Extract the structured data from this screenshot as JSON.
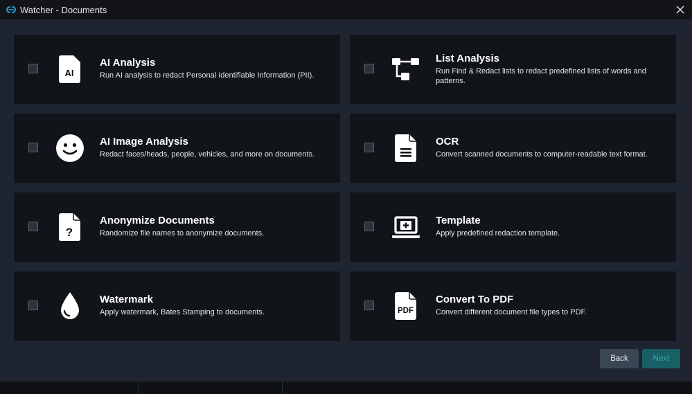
{
  "window": {
    "title": "Watcher - Documents",
    "close_glyph": "✕"
  },
  "cards": [
    {
      "title": "AI Analysis",
      "description": "Run AI analysis to redact Personal Identifiable Information (PII).",
      "icon": "ai-document-icon",
      "icon_text": "AI",
      "checked": false
    },
    {
      "title": "List Analysis",
      "description": "Run Find & Redact lists to redact predefined lists of words and patterns.",
      "icon": "flowchart-icon",
      "checked": false
    },
    {
      "title": "AI Image Analysis",
      "description": "Redact faces/heads, people, vehicles, and more on documents.",
      "icon": "smiley-face-icon",
      "checked": false
    },
    {
      "title": "OCR",
      "description": "Convert scanned documents to computer-readable text format.",
      "icon": "text-document-icon",
      "checked": false
    },
    {
      "title": "Anonymize Documents",
      "description": "Randomize file names to anonymize documents.",
      "icon": "question-document-icon",
      "icon_text": "?",
      "checked": false
    },
    {
      "title": "Template",
      "description": "Apply predefined redaction template.",
      "icon": "laptop-plus-icon",
      "checked": false
    },
    {
      "title": "Watermark",
      "description": "Apply watermark, Bates Stamping to documents.",
      "icon": "water-drop-icon",
      "checked": false
    },
    {
      "title": "Convert To PDF",
      "description": "Convert different document file types to PDF.",
      "icon": "pdf-document-icon",
      "icon_text": "PDF",
      "checked": false
    }
  ],
  "buttons": {
    "back": "Back",
    "next": "Next"
  },
  "colors": {
    "background": "#1e2530",
    "card": "#111419",
    "titlebar": "#121419",
    "next_button": "#185f66",
    "next_text": "#3aa7ad",
    "back_button": "#3b4654",
    "accent_logo": "#2ba0d8"
  }
}
